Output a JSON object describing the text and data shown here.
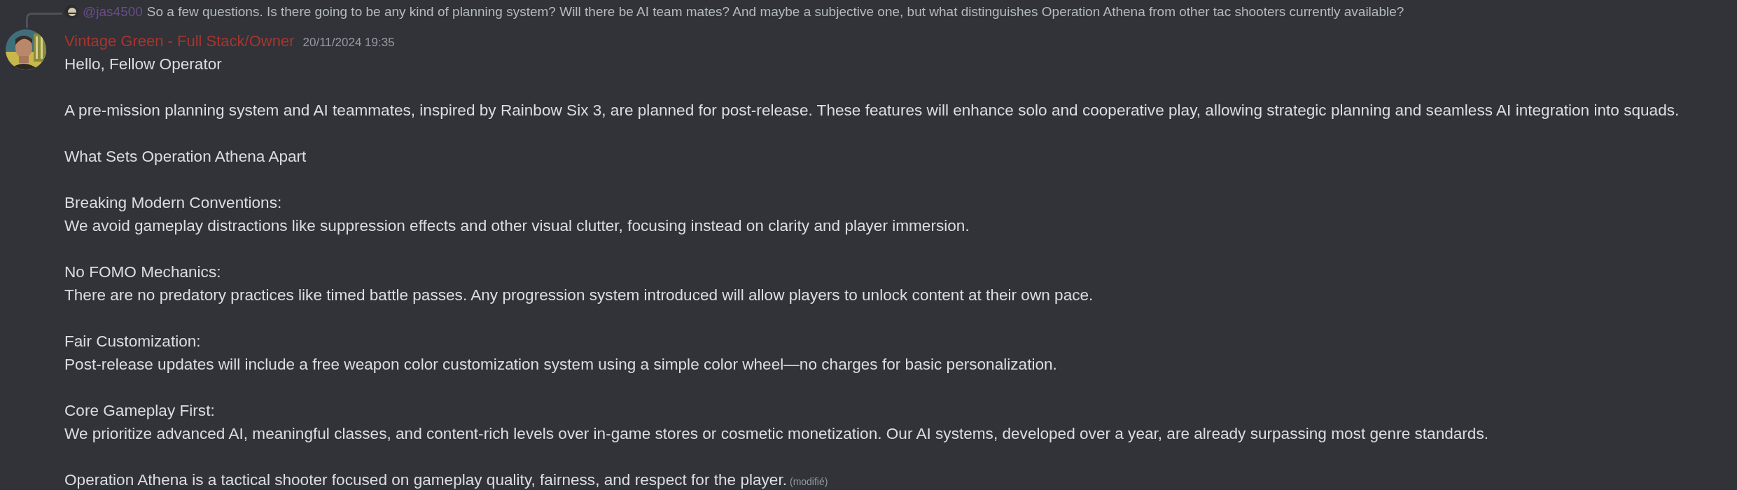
{
  "reply": {
    "username": "@jas4500",
    "text": "So a few questions. Is there going to be any kind of planning system? Will there be AI team mates? And maybe a subjective one, but what distinguishes Operation Athena from other tac shooters currently available?"
  },
  "message": {
    "author": "Vintage Green - Full Stack/Owner",
    "timestamp": "20/11/2024 19:35",
    "edited_label": "(modifié)",
    "paragraphs": [
      [
        "Hello, Fellow Operator"
      ],
      [
        "A pre-mission planning system and AI teammates, inspired by Rainbow Six 3, are planned for post-release. These features will enhance solo and cooperative play, allowing strategic planning and seamless AI integration into squads."
      ],
      [
        "What Sets Operation Athena Apart"
      ],
      [
        "Breaking Modern Conventions:",
        "We avoid gameplay distractions like suppression effects and other visual clutter, focusing instead on clarity and player immersion."
      ],
      [
        "No FOMO Mechanics:",
        "There are no predatory practices like timed battle passes. Any progression system introduced will allow players to unlock content at their own pace."
      ],
      [
        "Fair Customization:",
        "Post-release updates will include a free weapon color customization system using a simple color wheel—no charges for basic personalization."
      ],
      [
        "Core Gameplay First:",
        "We prioritize advanced AI, meaningful classes, and content-rich levels over in-game stores or cosmetic monetization. Our AI systems, developed over a year, are already surpassing most genre standards."
      ],
      [
        "Operation Athena is a tactical shooter focused on gameplay quality, fairness, and respect for the player."
      ]
    ]
  }
}
